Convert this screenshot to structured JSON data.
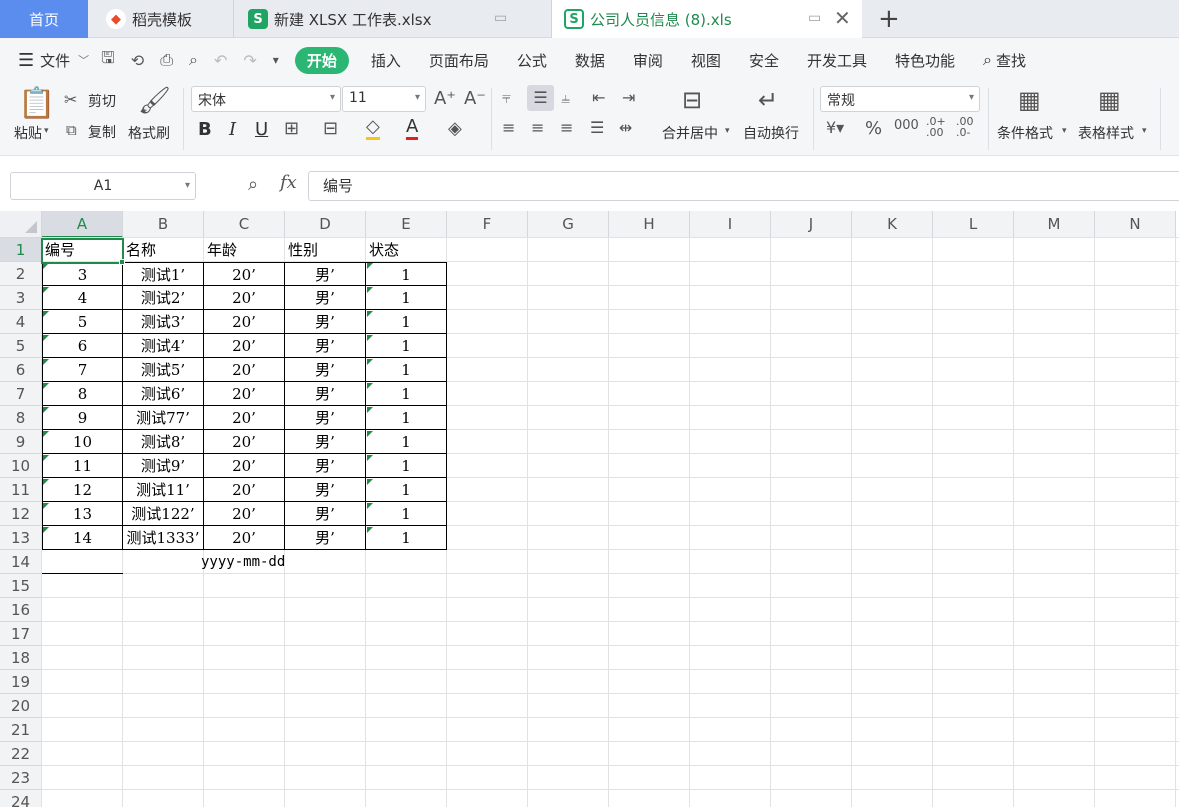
{
  "tabs": {
    "home": "首页",
    "daoke": "稻壳模板",
    "xlsx": "新建 XLSX 工作表.xlsx",
    "active": "公司人员信息 (8).xls"
  },
  "menu": {
    "file": "文件",
    "items": [
      "开始",
      "插入",
      "页面布局",
      "公式",
      "数据",
      "审阅",
      "视图",
      "安全",
      "开发工具",
      "特色功能"
    ],
    "search": "查找"
  },
  "ribbon": {
    "paste": "粘贴",
    "cut": "剪切",
    "copy": "复制",
    "format_painter": "格式刷",
    "font_name": "宋体",
    "font_size": "11",
    "merge_center": "合并居中",
    "wrap_text": "自动换行",
    "number_format": "常规",
    "conditional_format": "条件格式",
    "table_style": "表格样式"
  },
  "formula_bar": {
    "name_box": "A1",
    "fx": "fx",
    "content": "编号"
  },
  "sheet": {
    "columns": [
      "A",
      "B",
      "C",
      "D",
      "E",
      "F",
      "G",
      "H",
      "I",
      "J",
      "K",
      "L",
      "M",
      "N"
    ],
    "rows": [
      "1",
      "2",
      "3",
      "4",
      "5",
      "6",
      "7",
      "8",
      "9",
      "10",
      "11",
      "12",
      "13",
      "14",
      "15",
      "16",
      "17",
      "18",
      "19",
      "20",
      "21",
      "22",
      "23",
      "24"
    ],
    "header": [
      "编号",
      "名称",
      "年龄",
      "性别",
      "状态"
    ],
    "data": [
      [
        "3",
        "测试1’",
        "20’",
        "男’",
        "1"
      ],
      [
        "4",
        "测试2’",
        "20’",
        "男’",
        "1"
      ],
      [
        "5",
        "测试3’",
        "20’",
        "男’",
        "1"
      ],
      [
        "6",
        "测试4’",
        "20’",
        "男’",
        "1"
      ],
      [
        "7",
        "测试5’",
        "20’",
        "男’",
        "1"
      ],
      [
        "8",
        "测试6’",
        "20’",
        "男’",
        "1"
      ],
      [
        "9",
        "测试77’",
        "20’",
        "男’",
        "1"
      ],
      [
        "10",
        "测试8’",
        "20’",
        "男’",
        "1"
      ],
      [
        "11",
        "测试9’",
        "20’",
        "男’",
        "1"
      ],
      [
        "12",
        "测试11’",
        "20’",
        "男’",
        "1"
      ],
      [
        "13",
        "测试122’",
        "20’",
        "男’",
        "1"
      ],
      [
        "14",
        "测试1333’",
        "20’",
        "男’",
        "1"
      ]
    ],
    "row14_text": "yyyy-mm-dd"
  },
  "colors": {
    "accent": "#1f8a4c",
    "start_button": "#2bb673",
    "home_tab": "#5b8def"
  }
}
